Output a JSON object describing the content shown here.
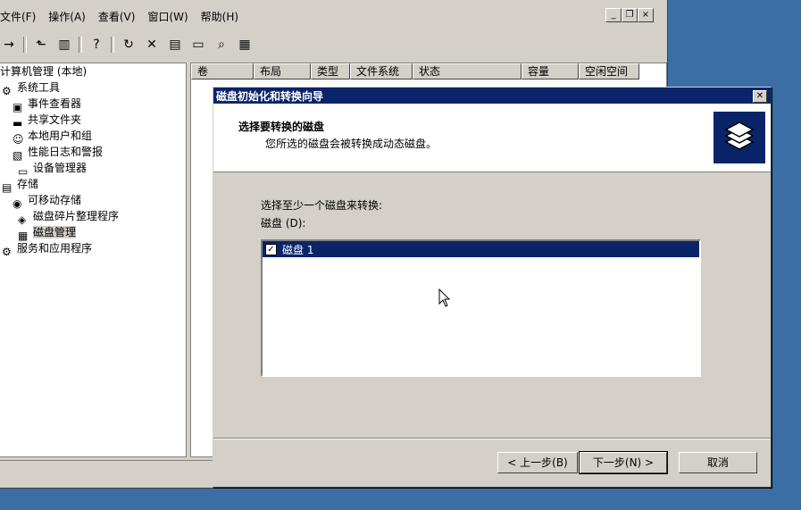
{
  "menu": [
    "文件(F)",
    "操作(A)",
    "查看(V)",
    "窗口(W)",
    "帮助(H)"
  ],
  "mdi_buttons": [
    "_",
    "❐",
    "×"
  ],
  "tree": {
    "root": "计算机管理 (本地)",
    "items": [
      {
        "label": "系统工具",
        "level": 1
      },
      {
        "label": "事件查看器",
        "level": 2
      },
      {
        "label": "共享文件夹",
        "level": 2
      },
      {
        "label": "本地用户和组",
        "level": 2
      },
      {
        "label": "性能日志和警报",
        "level": 2
      },
      {
        "label": "设备管理器",
        "level": 2
      },
      {
        "label": "存储",
        "level": 1
      },
      {
        "label": "可移动存储",
        "level": 2
      },
      {
        "label": "磁盘碎片整理程序",
        "level": 2
      },
      {
        "label": "磁盘管理",
        "level": 2
      },
      {
        "label": "服务和应用程序",
        "level": 1
      }
    ]
  },
  "columns": [
    "卷",
    "布局",
    "类型",
    "文件系统",
    "状态",
    "容量",
    "空闲空间"
  ],
  "dialog": {
    "title": "磁盘初始化和转换向导",
    "header_title": "选择要转换的磁盘",
    "header_subtitle": "您所选的磁盘会被转换成动态磁盘。",
    "instruction": "选择至少一个磁盘来转换:",
    "list_label": "磁盘 (D):",
    "disks": [
      {
        "label": "磁盘 1",
        "checked": true
      }
    ],
    "buttons": {
      "back": "< 上一步(B)",
      "next": "下一步(N) >",
      "cancel": "取消"
    }
  }
}
